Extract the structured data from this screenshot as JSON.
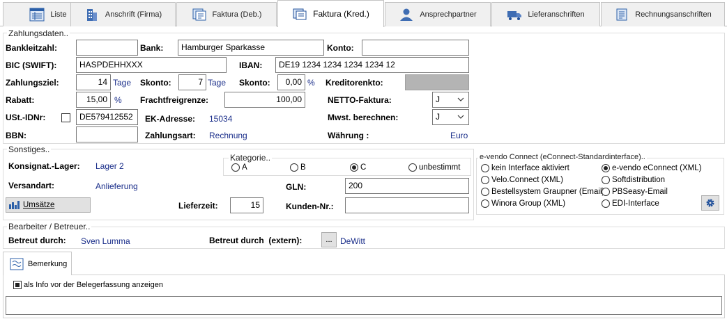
{
  "tabs": [
    {
      "label": "Liste",
      "icon": "list-icon"
    },
    {
      "label": "Anschrift (Firma)",
      "icon": "building-icon"
    },
    {
      "label": "Faktura (Deb.)",
      "icon": "invoice-debit-icon"
    },
    {
      "label": "Faktura (Kred.)",
      "icon": "invoice-credit-icon"
    },
    {
      "label": "Ansprechpartner",
      "icon": "contact-person-icon"
    },
    {
      "label": "Lieferanschriften",
      "icon": "truck-icon"
    },
    {
      "label": "Rechnungsanschriften",
      "icon": "billing-address-icon"
    }
  ],
  "zahlungsdaten": {
    "legend": "Zahlungsdaten..",
    "bankleitzahl_label": "Bankleitzahl:",
    "bankleitzahl_value": "",
    "bank_label": "Bank:",
    "bank_value": "Hamburger Sparkasse",
    "konto_label": "Konto:",
    "konto_value": "",
    "bic_label": "BIC (SWIFT):",
    "bic_value": "HASPDEHHXXX",
    "iban_label": "IBAN:",
    "iban_value": "DE19 1234 1234 1234 1234 12",
    "zahlungsziel_label": "Zahlungsziel:",
    "zahlungsziel_value": "14",
    "tage": "Tage",
    "skonto_days_label": "Skonto:",
    "skonto_days_value": "7",
    "skonto_pct_label": "Skonto:",
    "skonto_pct_value": "0,00",
    "percent": "%",
    "kreditorenkto_label": "Kreditorenkto:",
    "rabatt_label": "Rabatt:",
    "rabatt_value": "15,00",
    "frachtfreigrenze_label": "Frachtfreigrenze:",
    "frachtfreigrenze_value": "100,00",
    "netto_label": "NETTO-Faktura:",
    "netto_value": "J",
    "ustid_label": "USt.-IDNr:",
    "ustid_value": "DE579412552",
    "ek_adresse_label": "EK-Adresse:",
    "ek_adresse_value": "15034",
    "mwst_label": "Mwst. berechnen:",
    "mwst_value": "J",
    "bbn_label": "BBN:",
    "bbn_value": "",
    "zahlungsart_label": "Zahlungsart:",
    "zahlungsart_value": "Rechnung",
    "waehrung_label": "Währung :",
    "waehrung_value": "Euro"
  },
  "sonstiges": {
    "legend": "Sonstiges..",
    "konsignat_label": "Konsignat.-Lager:",
    "konsignat_value": "Lager 2",
    "versandart_label": "Versandart:",
    "versandart_value": "Anlieferung",
    "umsaetze_button": "Umsätze",
    "lieferzeit_label": "Lieferzeit:",
    "lieferzeit_value": "15",
    "gln_label": "GLN:",
    "gln_value": "200",
    "kundennr_label": "Kunden-Nr.:",
    "kundennr_value": "",
    "kategorie_legend": "Kategorie..",
    "kategorie_options": [
      "A",
      "B",
      "C",
      "unbestimmt"
    ],
    "kategorie_selected": "C"
  },
  "evendo": {
    "legend": "e-vendo Connect (eConnect-Standardinterface)..",
    "options": [
      "kein Interface aktiviert",
      "e-vendo eConnect (XML)",
      "Velo.Connect (XML)",
      "Softdistribution",
      "Bestellsystem Graupner (Email)",
      "PBSeasy-Email",
      "Winora Group (XML)",
      "EDI-Interface"
    ],
    "selected": "e-vendo eConnect (XML)"
  },
  "bearbeiter": {
    "legend": "Bearbeiter / Betreuer..",
    "betreut_label": "Betreut durch:",
    "betreut_value": "Sven Lumma",
    "betreut_extern_label": "Betreut durch  (extern):",
    "ellipsis": "...",
    "betreut_extern_value": "DeWitt"
  },
  "bemerkung": {
    "tab_label": "Bemerkung",
    "checkbox_label": "als Info vor der Belegerfassung anzeigen",
    "checkbox_checked": true,
    "text_value": ""
  },
  "colors": {
    "value_text": "#1a2e8a",
    "accent_icon": "#2b5fa8"
  }
}
